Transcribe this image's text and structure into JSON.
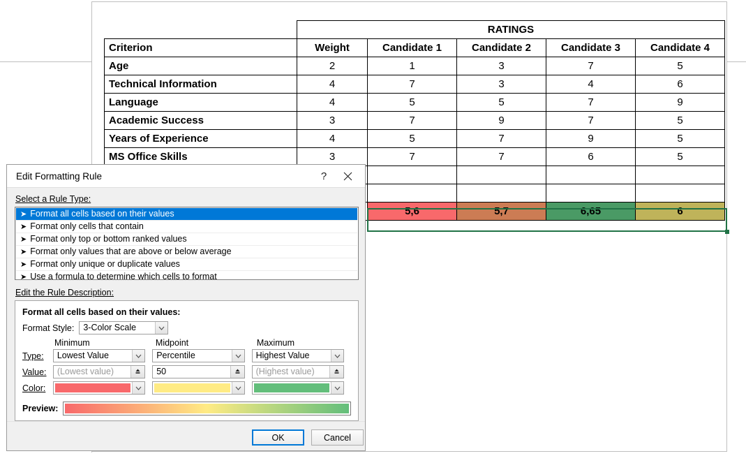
{
  "spreadsheet": {
    "banner": "RATINGS",
    "headers": [
      "Criterion",
      "Weight",
      "Candidate 1",
      "Candidate 2",
      "Candidate 3",
      "Candidate 4"
    ],
    "rows": [
      {
        "criterion": "Age",
        "weight": "2",
        "values": [
          "1",
          "3",
          "7",
          "5"
        ]
      },
      {
        "criterion": "Technical Information",
        "weight": "4",
        "values": [
          "7",
          "3",
          "4",
          "6"
        ]
      },
      {
        "criterion": "Language",
        "weight": "4",
        "values": [
          "5",
          "5",
          "7",
          "9"
        ]
      },
      {
        "criterion": "Academic Success",
        "weight": "3",
        "values": [
          "7",
          "9",
          "7",
          "5"
        ]
      },
      {
        "criterion": "Years of Experience",
        "weight": "4",
        "values": [
          "5",
          "7",
          "9",
          "5"
        ]
      },
      {
        "criterion": "MS Office Skills",
        "weight": "3",
        "values": [
          "7",
          "7",
          "6",
          "5"
        ]
      }
    ],
    "empty_rows": 2,
    "result_row": {
      "criterion": "",
      "weight": "",
      "values": [
        "5,6",
        "5,7",
        "6,65",
        "6"
      ],
      "colors": [
        "#F8696B",
        "#CC7C54",
        "#4A9A65",
        "#BFB35A"
      ]
    },
    "selection_color": "#217346"
  },
  "dialog": {
    "title": "Edit Formatting Rule",
    "help_icon": "question-mark-icon",
    "close_icon": "close-icon",
    "rule_type_label": "Select a Rule Type:",
    "rule_types": [
      {
        "label": "Format all cells based on their values",
        "selected": true
      },
      {
        "label": "Format only cells that contain",
        "selected": false
      },
      {
        "label": "Format only top or bottom ranked values",
        "selected": false
      },
      {
        "label": "Format only values that are above or below average",
        "selected": false
      },
      {
        "label": "Format only unique or duplicate values",
        "selected": false
      },
      {
        "label": "Use a formula to determine which cells to format",
        "selected": false
      }
    ],
    "description_label": "Edit the Rule Description:",
    "description_title": "Format all cells based on their values:",
    "format_style_label": "Format Style:",
    "format_style_value": "3-Color Scale",
    "column_heads": [
      "Minimum",
      "Midpoint",
      "Maximum"
    ],
    "row_labels": {
      "type": "Type:",
      "value": "Value:",
      "color": "Color:",
      "preview": "Preview:"
    },
    "type_values": [
      "Lowest Value",
      "Percentile",
      "Highest Value"
    ],
    "value_fields": [
      {
        "value": "(Lowest value)",
        "placeholder": true
      },
      {
        "value": "50",
        "placeholder": false
      },
      {
        "value": "(Highest value)",
        "placeholder": true
      }
    ],
    "colors": [
      "#F8696B",
      "#FFEB84",
      "#63BE7B"
    ],
    "preview_gradient": "linear-gradient(to right, #F8696B 0%, #FFEB84 50%, #63BE7B 100%)",
    "buttons": {
      "ok": "OK",
      "cancel": "Cancel"
    },
    "selection_highlight": "#0078D7"
  }
}
